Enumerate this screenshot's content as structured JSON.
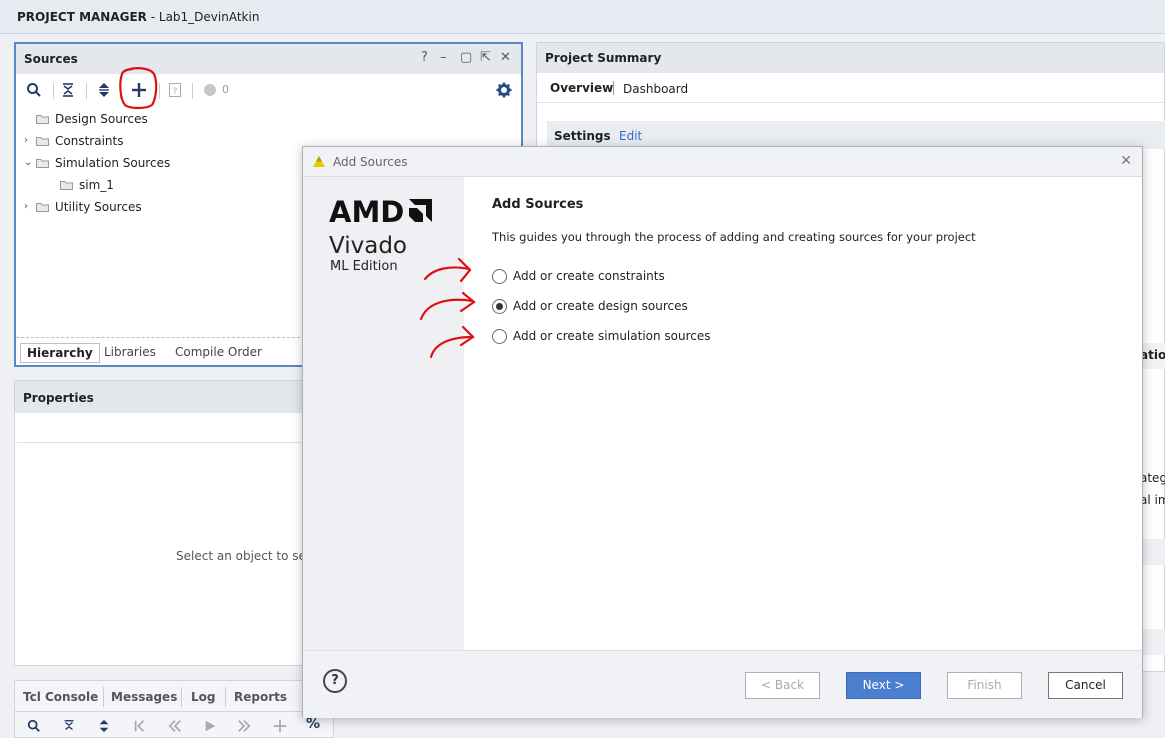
{
  "titlebar": {
    "section": "PROJECT MANAGER",
    "separator": " - ",
    "project": "Lab1_DevinAtkin"
  },
  "sources": {
    "title": "Sources",
    "controls": {
      "help": "?",
      "minimize": "–",
      "restore": "▢",
      "float": "⇱",
      "close": "✕"
    },
    "toolbar": {
      "count": "0"
    },
    "tree": [
      {
        "label": "Design Sources",
        "expander": ""
      },
      {
        "label": "Constraints",
        "expander": "›"
      },
      {
        "label": "Simulation Sources",
        "expander": "⌄"
      },
      {
        "label": "sim_1",
        "expander": ""
      },
      {
        "label": "Utility Sources",
        "expander": "›"
      }
    ],
    "tabs": [
      "Hierarchy",
      "Libraries",
      "Compile Order"
    ]
  },
  "properties": {
    "title": "Properties",
    "message": "Select an object to see"
  },
  "tcl": {
    "tabs": [
      "Tcl Console",
      "Messages",
      "Log",
      "Reports"
    ],
    "percent_label": "%"
  },
  "summary": {
    "title": "Project Summary",
    "tabs": [
      "Overview",
      "Dashboard"
    ],
    "settings_label": "Settings",
    "edit_link": "Edit",
    "clipped": [
      "ation",
      "ategy",
      "al im"
    ]
  },
  "dialog": {
    "title": "Add Sources",
    "close": "✕",
    "brand": {
      "amd": "AMD",
      "vivado": "Vivado",
      "edition": "ML Edition"
    },
    "heading": "Add Sources",
    "description": "This guides you through the process of adding and creating sources for your project",
    "options": [
      {
        "label": "Add or create constraints",
        "selected": false
      },
      {
        "label": "Add or create design sources",
        "selected": true
      },
      {
        "label": "Add or create simulation sources",
        "selected": false
      }
    ],
    "help": "?",
    "buttons": {
      "back": "< Back",
      "next": "Next >",
      "finish": "Finish",
      "cancel": "Cancel"
    }
  },
  "colors": {
    "accent": "#4a7fd0",
    "panel_border": "#5b87c5",
    "annotation": "#e01010"
  },
  "icons": [
    "search-icon",
    "collapse-all-icon",
    "expand-all-icon",
    "add-icon",
    "unknown-file-icon",
    "status-dot-icon",
    "gear-icon",
    "folder-icon",
    "vivado-logo-icon",
    "help-icon"
  ]
}
